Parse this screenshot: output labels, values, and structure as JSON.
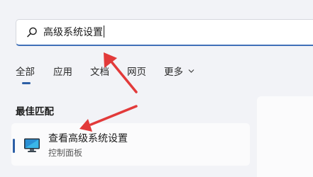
{
  "search": {
    "value": "高级系统设置"
  },
  "tabs": [
    {
      "label": "全部"
    },
    {
      "label": "应用"
    },
    {
      "label": "文档"
    },
    {
      "label": "网页"
    },
    {
      "label": "更多"
    }
  ],
  "section": {
    "title": "最佳匹配"
  },
  "best_match": {
    "title": "查看高级系统设置",
    "subtitle": "控制面板"
  },
  "colors": {
    "accent": "#2d5fa6",
    "annotation_arrow": "#e23a3a"
  },
  "icons": [
    "search-icon",
    "chevron-down-icon",
    "control-panel-monitor-icon"
  ]
}
